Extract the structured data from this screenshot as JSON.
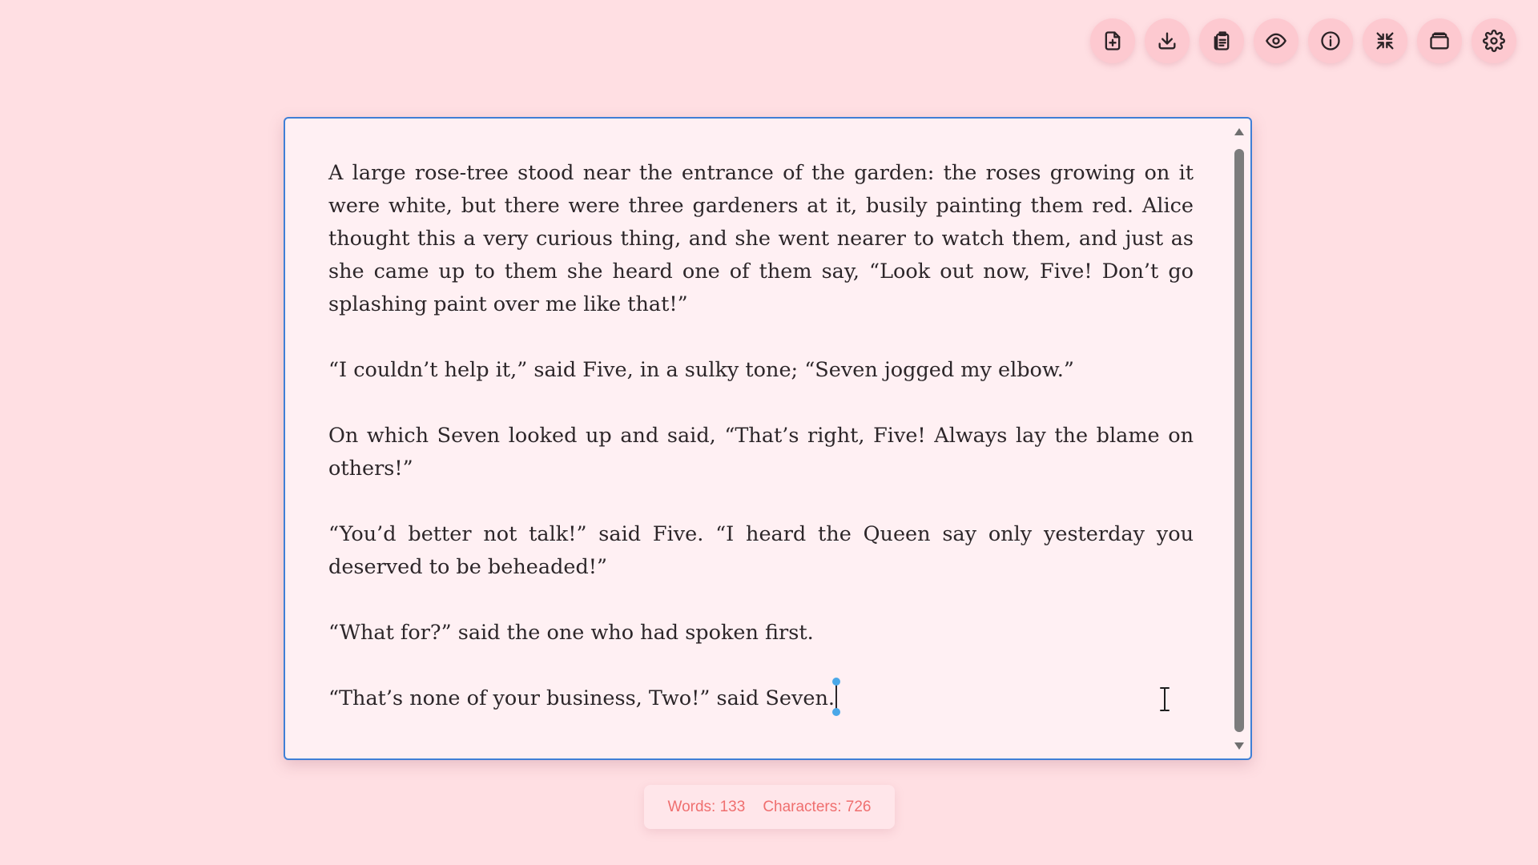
{
  "toolbar": {
    "buttons": [
      {
        "name": "new-document",
        "icon": "file-plus-icon"
      },
      {
        "name": "download",
        "icon": "download-icon"
      },
      {
        "name": "copy",
        "icon": "clipboard-icon"
      },
      {
        "name": "preview",
        "icon": "eye-icon"
      },
      {
        "name": "info",
        "icon": "info-icon"
      },
      {
        "name": "collapse",
        "icon": "minimize-icon"
      },
      {
        "name": "archive",
        "icon": "archive-icon"
      },
      {
        "name": "settings",
        "icon": "gear-icon"
      }
    ]
  },
  "editor": {
    "paragraphs": [
      "A large rose-tree stood near the entrance of the garden: the roses growing on it were white, but there were three gardeners at it, busily painting them red. Alice thought this a very curious thing, and she went nearer to watch them, and just as she came up to them she heard one of them say, “Look out now, Five! Don’t go splashing paint over me like that!”",
      "“I couldn’t help it,” said Five, in a sulky tone; “Seven jogged my elbow.”",
      "On which Seven looked up and said, “That’s right, Five! Always lay the blame on others!”",
      "“You’d better not talk!” said Five. “I heard the Queen say only yesterday you deserved to be beheaded!”",
      "“What for?” said the one who had spoken first.",
      "“That’s none of your business, Two!” said Seven."
    ]
  },
  "stats": {
    "words": "Words: 133",
    "characters": "Characters: 726"
  },
  "colors": {
    "background": "#ffdfe3",
    "button": "#fdc9d0",
    "editor_bg": "#fff0f3",
    "editor_border": "#3f7fd6",
    "stats_text": "#ef6f6f"
  }
}
